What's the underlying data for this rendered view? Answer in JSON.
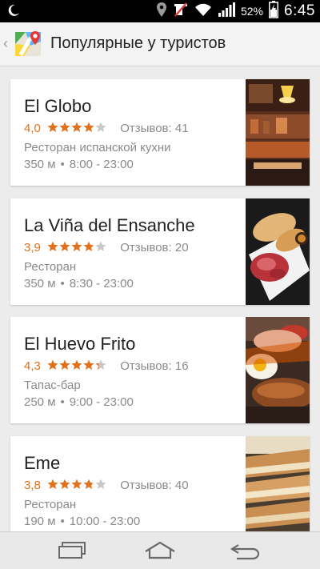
{
  "status_bar": {
    "battery_percent": "52%",
    "time": "6:45",
    "icons": [
      "moon-icon",
      "location-icon",
      "muted-icon",
      "wifi-icon",
      "signal-icon",
      "battery-icon"
    ]
  },
  "action_bar": {
    "title": "Популярные у туристов",
    "app_icon": "maps-icon"
  },
  "places": [
    {
      "name": "El Globo",
      "rating": "4,0",
      "stars": 4.0,
      "reviews": "Отзывов: 41",
      "category": "Ресторан испанской кухни",
      "distance": "350 м",
      "hours": "8:00 - 23:00",
      "photo": "cafe-interior"
    },
    {
      "name": "La Viña del Ensanche",
      "rating": "3,9",
      "stars": 3.9,
      "reviews": "Отзывов: 20",
      "category": "Ресторан",
      "distance": "350 м",
      "hours": "8:30 - 23:00",
      "photo": "ham-plate"
    },
    {
      "name": "El Huevo Frito",
      "rating": "4,3",
      "stars": 4.3,
      "reviews": "Отзывов: 16",
      "category": "Тапас-бар",
      "distance": "250 м",
      "hours": "9:00 - 23:00",
      "photo": "fried-egg"
    },
    {
      "name": "Eme",
      "rating": "3,8",
      "stars": 3.8,
      "reviews": "Отзывов: 40",
      "category": "Ресторан",
      "distance": "190 м",
      "hours": "10:00 - 23:00",
      "photo": "sandwiches"
    }
  ],
  "nav_bar": {
    "buttons": [
      "recent-apps-icon",
      "home-icon",
      "back-icon"
    ]
  },
  "colors": {
    "accent_orange": "#e2711d",
    "secondary_text": "#8a8a8a",
    "background": "#ececec"
  }
}
